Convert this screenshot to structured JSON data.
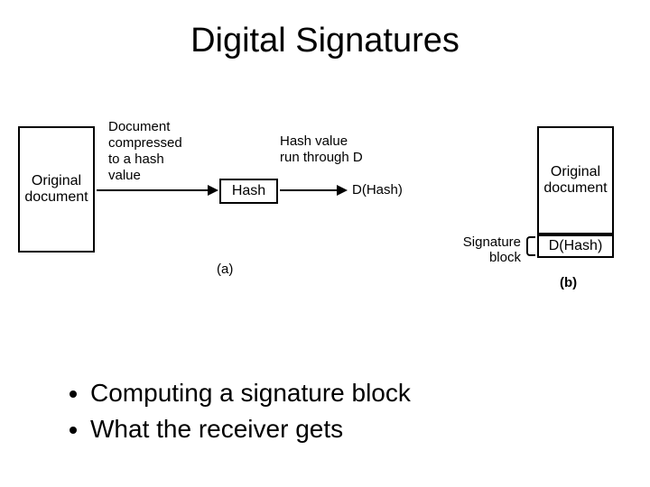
{
  "title": "Digital Signatures",
  "diagram": {
    "box_original_a": "Original\ndocument",
    "box_hash": "Hash",
    "box_dhash": "D(Hash)",
    "box_original_b": "Original\ndocument",
    "box_sig_dhash": "D(Hash)",
    "label_compress": "Document\ncompressed\nto a hash\nvalue",
    "label_runD": "Hash value\nrun through D",
    "label_sigblock": "Signature\nblock",
    "fig_a": "(a)",
    "fig_b": "(b)"
  },
  "bullets": [
    "Computing a signature block",
    "What the receiver gets"
  ]
}
